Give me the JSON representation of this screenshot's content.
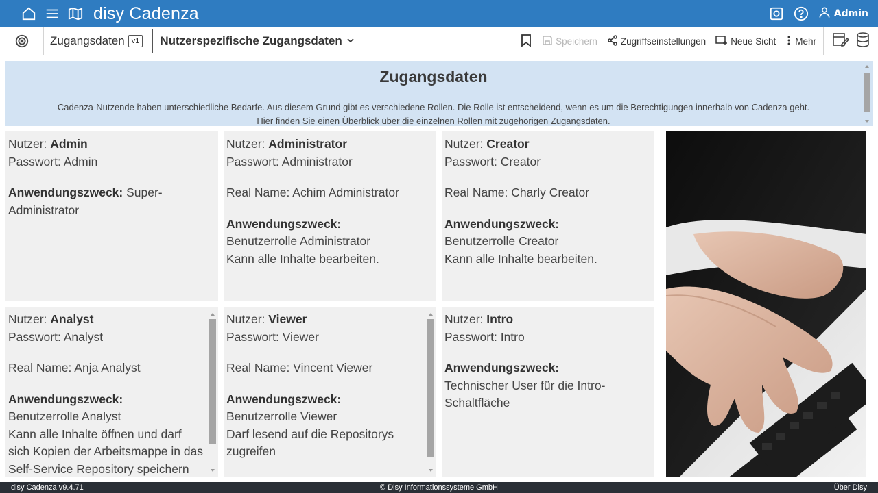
{
  "app": {
    "title": "disy Cadenza",
    "user": "Admin"
  },
  "toolbar": {
    "workbook": "Zugangsdaten",
    "version": "v1",
    "view": "Nutzerspezifische Zugangsdaten",
    "save": "Speichern",
    "access": "Zugriffseinstellungen",
    "new_view": "Neue Sicht",
    "more": "Mehr"
  },
  "header": {
    "title": "Zugangsdaten",
    "line1": "Cadenza-Nutzende haben unterschiedliche Bedarfe. Aus diesem Grund gibt es verschiedene Rollen. Die Rolle ist entscheidend, wenn es um die Berechtigungen innerhalb von Cadenza geht.",
    "line2": "Hier finden Sie einen Überblick über die einzelnen Rollen mit zugehörigen Zugangsdaten."
  },
  "labels": {
    "user": "Nutzer: ",
    "password": "Passwort: ",
    "realname": "Real Name: ",
    "purpose": "Anwendungszweck:"
  },
  "cards": {
    "admin": {
      "user": "Admin",
      "password": "Admin",
      "purpose_inline": " Super-Administrator"
    },
    "administrator": {
      "user": "Administrator",
      "password": "Administrator",
      "realname": "Achim Administrator",
      "purpose1": "Benutzerrolle Administrator",
      "purpose2": "Kann alle Inhalte bearbeiten."
    },
    "creator": {
      "user": "Creator",
      "password": "Creator",
      "realname": "Charly Creator",
      "purpose1": "Benutzerrolle Creator",
      "purpose2": "Kann alle Inhalte bearbeiten."
    },
    "analyst": {
      "user": "Analyst",
      "password": "Analyst",
      "realname": "Anja Analyst",
      "purpose1": "Benutzerrolle Analyst",
      "purpose2": "Kann alle Inhalte öffnen und darf sich Kopien der Arbeitsmappe in das Self-Service Repository speichern"
    },
    "viewer": {
      "user": "Viewer",
      "password": "Viewer",
      "realname": "Vincent Viewer",
      "purpose1": "Benutzerrolle Viewer",
      "purpose2": "Darf lesend auf die Repositorys zugreifen"
    },
    "intro": {
      "user": "Intro",
      "password": "Intro",
      "purpose1": "Technischer User für die Intro-Schaltfläche"
    }
  },
  "footer": {
    "version": "disy Cadenza v9.4.71",
    "copyright": "© Disy Informationssysteme GmbH",
    "about": "Über Disy"
  },
  "colors": {
    "topbar": "#2f7cc1",
    "header_panel": "#d3e3f3",
    "card_bg": "#f0f0f0",
    "footer": "#2a2f36"
  },
  "icons": [
    "home-icon",
    "menu-icon",
    "map-icon",
    "settings-icon",
    "help-icon",
    "user-icon",
    "target-icon",
    "bookmark-icon",
    "save-icon",
    "share-icon",
    "new-view-icon",
    "more-icon",
    "edit-icon",
    "database-icon",
    "chevron-down-icon"
  ]
}
